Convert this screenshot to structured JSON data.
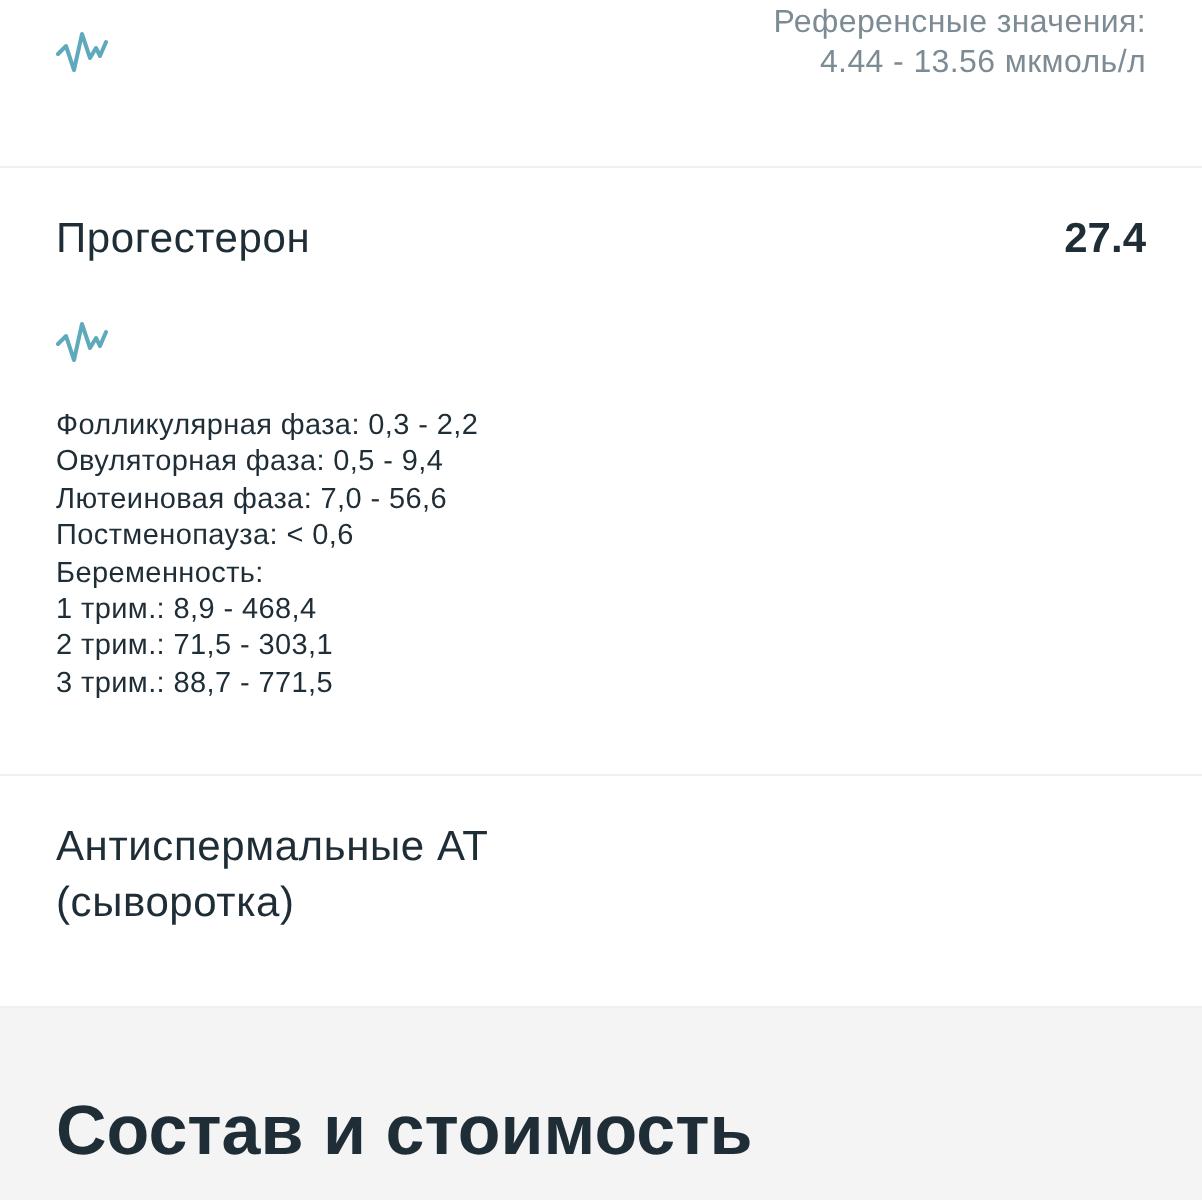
{
  "tests": [
    {
      "kind": "summary",
      "chart_icon": true,
      "reference": [
        "Референсные значения:",
        "4.44 - 13.56 мкмоль/л"
      ]
    },
    {
      "kind": "detailed",
      "name": "Прогестерон",
      "value": "27.4",
      "chart_icon": true,
      "reference": [
        "Фолликулярная фаза: 0,3 - 2,2",
        "Овуляторная фаза: 0,5 - 9,4",
        "Лютеиновая фаза: 7,0 - 56,6",
        "Постменопауза: < 0,6",
        "Беременность:",
        "1 трим.: 8,9 - 468,4",
        "2 трим.: 71,5 - 303,1",
        "3 трим.: 88,7 - 771,5"
      ]
    },
    {
      "kind": "detailed",
      "name": "Антиспермальные АТ\n(сыворотка)",
      "chart_icon": false
    }
  ],
  "section": {
    "title": "Состав и стоимость"
  }
}
